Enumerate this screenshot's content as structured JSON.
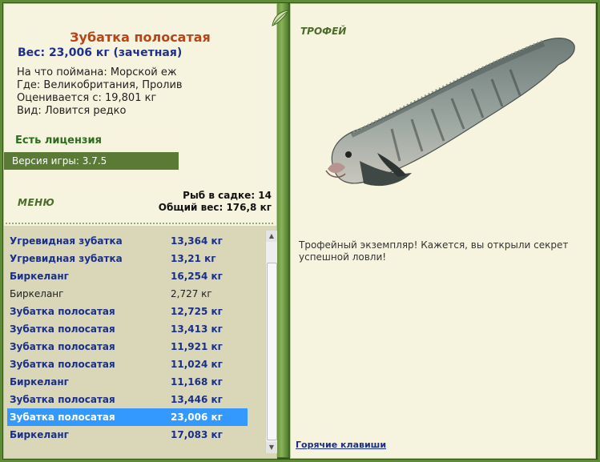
{
  "catch": {
    "fish_name": "Зубатка полосатая",
    "weight_line": "Вес: 23,006 кг (зачетная)",
    "bait_line": "На что поймана: Морской еж",
    "location_line": "Где: Великобритания, Пролив",
    "value_line": "Оценивается с: 19,801 кг",
    "type_line": "Вид: Ловится редко"
  },
  "license_label": "Есть лицензия",
  "version_label": "Версия игры: 3.7.5",
  "menu_label": "МЕНЮ",
  "stats": {
    "fish_count": "Рыб в садке: 14",
    "total_weight": "Общий вес: 176,8 кг"
  },
  "fish_list": [
    {
      "name": "Угревидная зубатка",
      "weight": "13,364 кг"
    },
    {
      "name": "Угревидная зубатка",
      "weight": "13,21 кг"
    },
    {
      "name": "Биркеланг",
      "weight": "16,254 кг"
    },
    {
      "name": "Биркеланг",
      "weight": "2,727 кг"
    },
    {
      "name": "Зубатка полосатая",
      "weight": "12,725 кг"
    },
    {
      "name": "Зубатка полосатая",
      "weight": "13,413 кг"
    },
    {
      "name": "Зубатка полосатая",
      "weight": "11,921 кг"
    },
    {
      "name": "Зубатка полосатая",
      "weight": "11,024 кг"
    },
    {
      "name": "Биркеланг",
      "weight": "11,168 кг"
    },
    {
      "name": "Зубатка полосатая",
      "weight": "13,446 кг"
    },
    {
      "name": "Зубатка полосатая",
      "weight": "23,006 кг"
    },
    {
      "name": "Биркеланг",
      "weight": "17,083 кг"
    }
  ],
  "trophy_label": "ТРОФЕЙ",
  "trophy_description": "Трофейный экземпляр! Кажется, вы открыли секрет успешной ловли!",
  "hotkeys_label": "Горячие клавиши",
  "icons": {
    "menu": "leaf-icon",
    "trophy": "leaf-icon",
    "fish_picture": "wolffish-picture"
  },
  "colors": {
    "frame": "#4f7a2f",
    "panel": "#f6f3df",
    "list_bg": "#d9d7b7",
    "selection": "#3399ff",
    "fish_name": "#b5451b",
    "link": "#1a2f8a"
  }
}
